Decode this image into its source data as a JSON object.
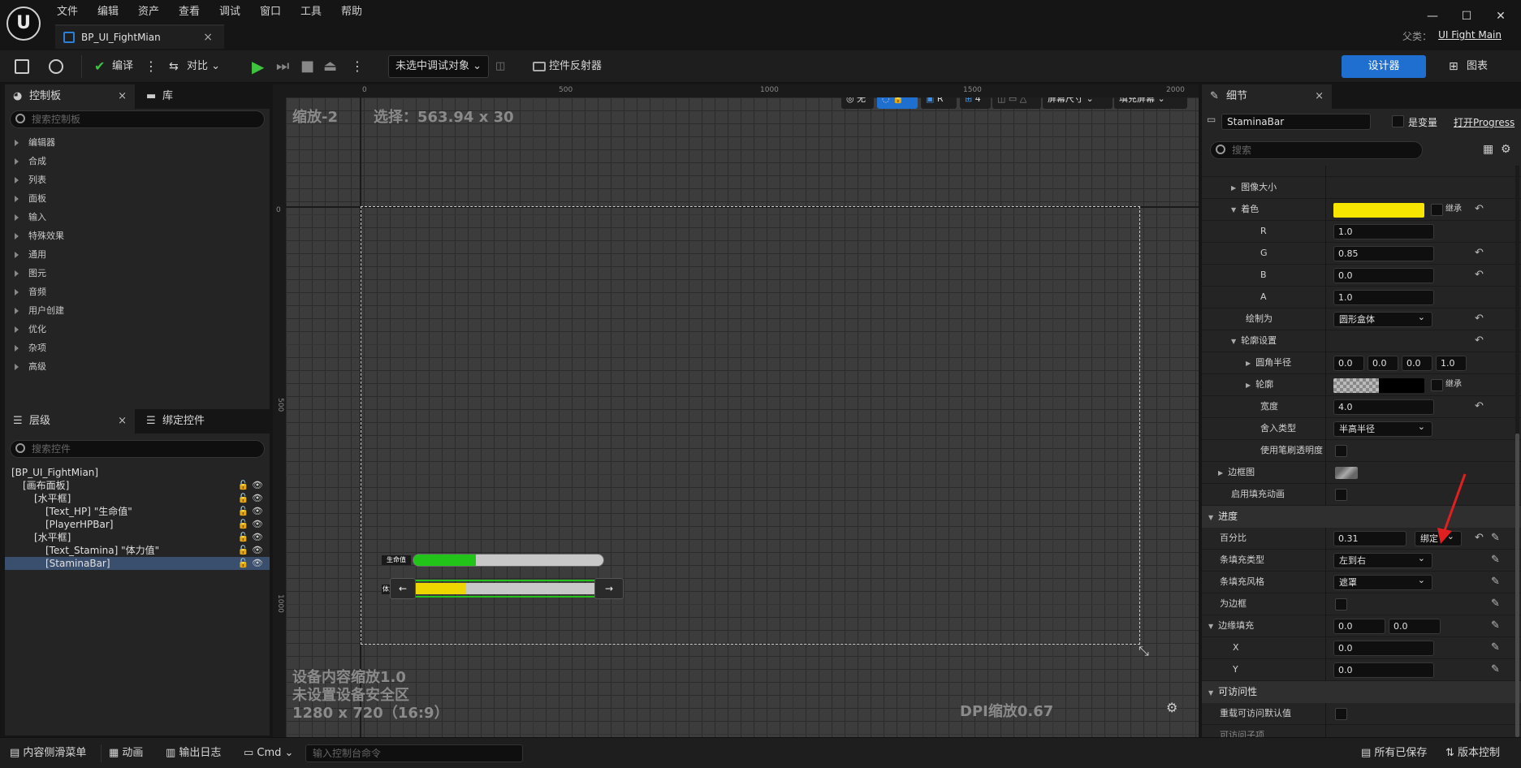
{
  "menu": [
    "文件",
    "编辑",
    "资产",
    "查看",
    "调试",
    "窗口",
    "工具",
    "帮助"
  ],
  "document_tab": "BP_UI_FightMian",
  "parent_label": "父类：",
  "parent_class": "UI Fight Main",
  "toolbar": {
    "compile_label": "编译",
    "diff_label": "对比",
    "debug_object": "未选中调试对象",
    "widget_reflector": "控件反射器",
    "designer_label": "设计器",
    "graph_label": "图表"
  },
  "palette": {
    "tab_label": "控制板",
    "library_tab": "库",
    "search_placeholder": "搜索控制板",
    "categories": [
      "编辑器",
      "合成",
      "列表",
      "面板",
      "输入",
      "特殊效果",
      "通用",
      "图元",
      "音频",
      "用户创建",
      "优化",
      "杂项",
      "高级"
    ]
  },
  "hierarchy": {
    "tab_label": "层级",
    "bind_tab": "绑定控件",
    "search_placeholder": "搜索控件",
    "items": [
      {
        "label": "[BP_UI_FightMian]",
        "indent": 0
      },
      {
        "label": "[画布面板]",
        "indent": 1
      },
      {
        "label": "[水平框]",
        "indent": 2
      },
      {
        "label": "[Text_HP] \"生命值\"",
        "indent": 3
      },
      {
        "label": "[PlayerHPBar]",
        "indent": 3
      },
      {
        "label": "[水平框]",
        "indent": 2
      },
      {
        "label": "[Text_Stamina] \"体力值\"",
        "indent": 3
      },
      {
        "label": "[StaminaBar]",
        "indent": 3
      }
    ]
  },
  "viewport": {
    "zoom": "缩放-2",
    "selection": "选择：563.94 x 30",
    "ruler_top": [
      "0",
      "500",
      "1000",
      "1500",
      "2000"
    ],
    "ruler_left": [
      "0",
      "500",
      "1000"
    ],
    "btn_none": "无",
    "btn_r": "R",
    "grid_snap": "4",
    "screen_size": "屏幕尺寸",
    "fill_screen": "填充屏幕",
    "device_scale": "设备内容缩放1.0",
    "safe_zone": "未设置设备安全区",
    "resolution": "1280 x 720（16:9）",
    "dpi_scale": "DPI缩放0.67",
    "hp_label": "生命值",
    "stamina_label": "体力值",
    "hp_percent": 0.33,
    "stamina_percent": 0.31,
    "hp_color": "#22c41a",
    "stamina_color": "#f0d600"
  },
  "details": {
    "tab_label": "细节",
    "widget_name": "StaminaBar",
    "is_variable": "是变量",
    "open_link": "打开Progress",
    "search_placeholder": "搜索",
    "rows": {
      "image_size": "图像大小",
      "tint": "着色",
      "inherit": "继承",
      "r_label": "R",
      "r_value": "1.0",
      "g_label": "G",
      "g_value": "0.85",
      "b_label": "B",
      "b_value": "0.0",
      "a_label": "A",
      "a_value": "1.0",
      "draw_as": "绘制为",
      "draw_as_value": "圆形盒体",
      "outline_settings": "轮廓设置",
      "corner_radius": "圆角半径",
      "corner_values": [
        "0.0",
        "0.0",
        "0.0",
        "1.0"
      ],
      "outline": "轮廓",
      "outline_inherit": "继承",
      "width": "宽度",
      "width_value": "4.0",
      "rounding_type": "舍入类型",
      "rounding_value": "半高半径",
      "use_brush_alpha": "使用笔刷透明度",
      "border_image": "边框图",
      "enable_fill_anim": "启用填充动画"
    },
    "progress": {
      "section": "进度",
      "percent": "百分比",
      "percent_value": "0.31",
      "bind": "绑定",
      "bar_fill_type": "条填充类型",
      "bar_fill_type_value": "左到右",
      "bar_fill_style": "条填充风格",
      "bar_fill_style_value": "遮罩",
      "is_marquee": "为边框",
      "border_padding": "边缘填充",
      "border_padding_values": [
        "0.0",
        "0.0"
      ],
      "x_label": "X",
      "x_value": "0.0",
      "y_label": "Y",
      "y_value": "0.0"
    },
    "accessibility": {
      "section": "可访问性",
      "override": "重载可访问默认值",
      "children": "可访问子项"
    }
  },
  "status": {
    "content_drawer": "内容侧滑菜单",
    "animation": "动画",
    "output_log": "输出日志",
    "cmd": "Cmd",
    "console_placeholder": "输入控制台命令",
    "saved": "所有已保存",
    "source_control": "版本控制"
  }
}
